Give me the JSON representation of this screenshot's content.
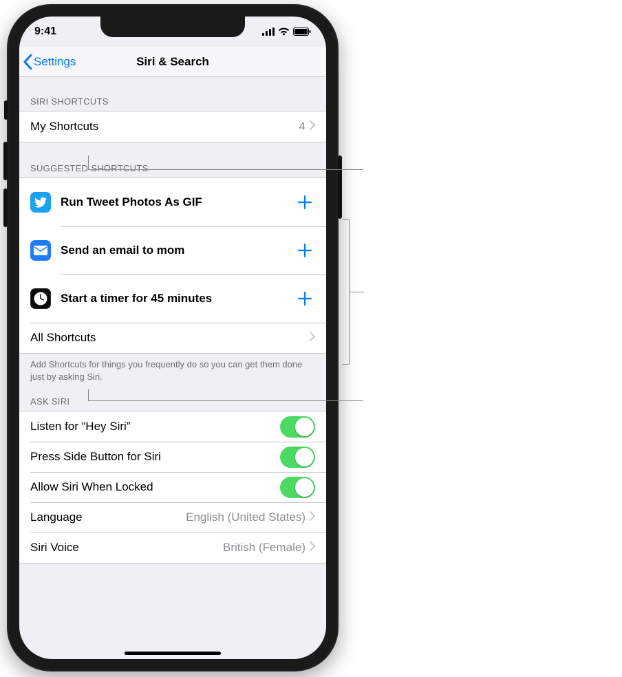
{
  "status": {
    "time": "9:41"
  },
  "nav": {
    "back": "Settings",
    "title": "Siri & Search"
  },
  "siri_shortcuts": {
    "header": "Siri Shortcuts",
    "my_label": "My Shortcuts",
    "my_count": "4"
  },
  "suggested": {
    "header": "Suggested Shortcuts",
    "items": [
      {
        "title": "Run Tweet Photos As GIF",
        "icon": "twitter"
      },
      {
        "title": "Send an email to mom",
        "icon": "mail"
      },
      {
        "title": "Start a timer for 45 minutes",
        "icon": "clock"
      }
    ],
    "all_label": "All Shortcuts",
    "footer": "Add Shortcuts for things you frequently do so you can get them done just by asking Siri."
  },
  "ask_siri": {
    "header": "Ask Siri",
    "items": [
      {
        "label": "Listen for “Hey Siri”",
        "on": true
      },
      {
        "label": "Press Side Button for Siri",
        "on": true
      },
      {
        "label": "Allow Siri When Locked",
        "on": true
      }
    ],
    "language_label": "Language",
    "language_value": "English (United States)",
    "voice_label": "Siri Voice",
    "voice_value": "British (Female)"
  }
}
